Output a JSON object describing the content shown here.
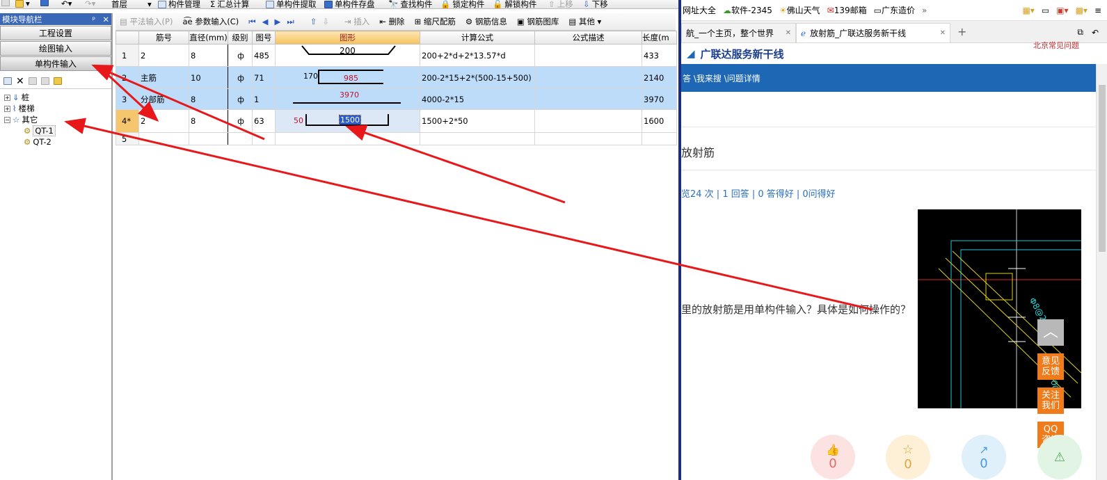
{
  "left_app": {
    "toolbar1": {
      "floor": "首层",
      "items": [
        "构件管理",
        "汇总计算",
        "单构件提取",
        "单构件存盘",
        "查找构件",
        "锁定构件",
        "解锁构件",
        "上移",
        "下移"
      ]
    },
    "nav": {
      "title": "模块导航栏",
      "pin": "ᵖ",
      "close": "✕",
      "buttons": [
        "工程设置",
        "绘图输入",
        "单构件输入"
      ],
      "tree": {
        "pile": "桩",
        "stairs": "楼梯",
        "other": "其它",
        "children": [
          "QT-1",
          "QT-2"
        ]
      }
    },
    "toolbar2": {
      "items": [
        "平法输入(P)",
        "参数输入(C)",
        "插入",
        "删除",
        "缩尺配筋",
        "钢筋信息",
        "钢筋图库",
        "其他"
      ]
    },
    "table": {
      "headers": [
        "",
        "筋号",
        "直径(mm)",
        "级别",
        "图号",
        "图形",
        "计算公式",
        "公式描述",
        "长度(m"
      ],
      "rows": [
        {
          "rn": "1",
          "name": "2",
          "dia": "8",
          "grade": "ф",
          "fig": "485",
          "shape_vals": [
            "200"
          ],
          "formula": "200+2*d+2*13.57*d",
          "desc": "",
          "len": "433"
        },
        {
          "rn": "2",
          "name": "主筋",
          "dia": "10",
          "grade": "ф",
          "fig": "71",
          "shape_vals": [
            "170",
            "985"
          ],
          "formula": "200-2*15+2*(500-15+500)",
          "desc": "",
          "len": "2140"
        },
        {
          "rn": "3",
          "name": "分部筋",
          "dia": "8",
          "grade": "ф",
          "fig": "1",
          "shape_vals": [
            "3970"
          ],
          "formula": "4000-2*15",
          "desc": "",
          "len": "3970"
        },
        {
          "rn": "4*",
          "name": "2",
          "dia": "8",
          "grade": "ф",
          "fig": "63",
          "shape_vals": [
            "50",
            "1500"
          ],
          "formula": "1500+2*50",
          "desc": "",
          "len": "1600"
        },
        {
          "rn": "5",
          "name": "",
          "dia": "",
          "grade": "",
          "fig": "",
          "shape_vals": [],
          "formula": "",
          "desc": "",
          "len": ""
        }
      ]
    }
  },
  "browser": {
    "favorites": [
      "网址大全",
      "软件-2345",
      "佛山天气",
      "139邮箱",
      "广东造价",
      "»"
    ],
    "tabs": [
      {
        "title": "航_一个主页，整个世界",
        "close": "✕"
      },
      {
        "title": "放射筋_广联达服务新干线",
        "close": "✕"
      }
    ],
    "new_tab": "+",
    "top_right_link": "北京常见问题",
    "site_title": "广联达服务新干线",
    "breadcrumb": "答 \\我来搜 \\问题详情",
    "question_title": "放射筋",
    "stats": "览24 次 | 1 回答 | 0 答得好 | 0问得好",
    "question_text": "里的放射筋是用单构件输入？具体是如何操作的？",
    "side_buttons": [
      "意见反馈",
      "关注我们",
      "QQ咨询"
    ],
    "counters": [
      "0",
      "0",
      "0"
    ],
    "cad_labels": [
      "Φ8@200",
      "Φ8@200"
    ]
  },
  "colors": {
    "arrow": "#e8181a",
    "nav_title_bg": "#3a67b6",
    "selected_row": "#bcdcf9",
    "breadcrumb_bg": "#1e67b5",
    "side_button": "#f07b1a"
  }
}
